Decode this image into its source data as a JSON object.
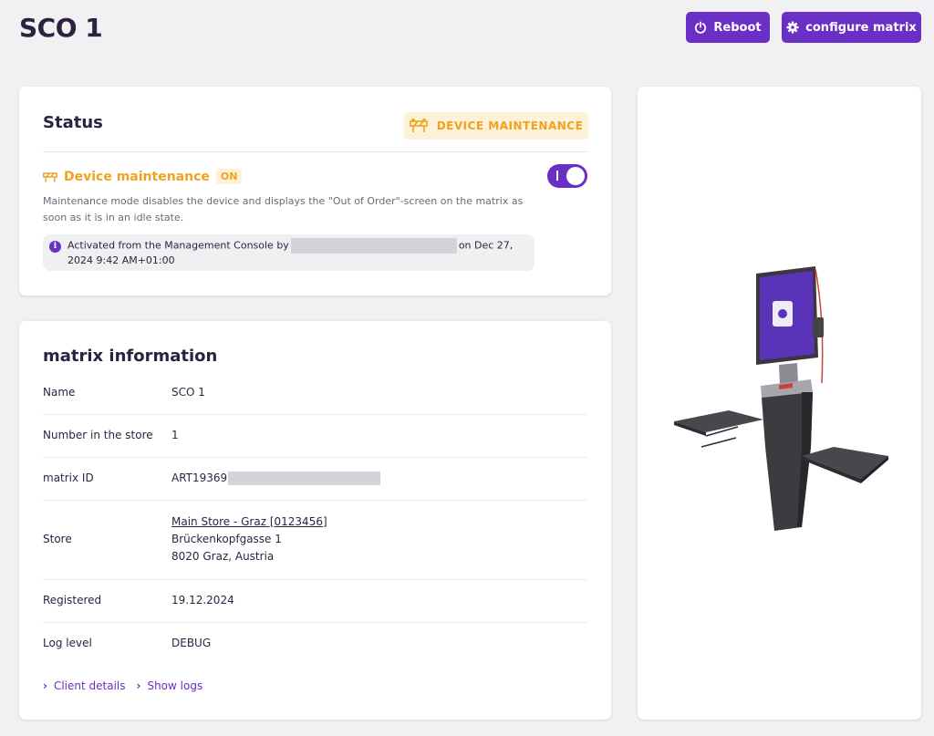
{
  "page": {
    "title": "SCO 1"
  },
  "toolbar": {
    "reboot_label": "Reboot",
    "configure_label": "configure matrix",
    "accent_color": "#6a2fc4"
  },
  "status": {
    "title": "Status",
    "badge_label": "DEVICE MAINTENANCE",
    "maintenance_label": "Device maintenance",
    "maintenance_state": "ON",
    "toggle_on": true,
    "description": "Maintenance mode disables the device and displays the \"Out of Order\"-screen on the matrix as soon as it is in an idle state.",
    "activation_prefix": "Activated from the Management Console by",
    "activation_suffix": "on Dec 27, 2024 9:42 AM+01:00",
    "warning_color": "#f0a21f"
  },
  "info": {
    "title": "matrix information",
    "rows": {
      "name": {
        "label": "Name",
        "value": "SCO 1"
      },
      "number": {
        "label": "Number in the store",
        "value": "1"
      },
      "matrix_id": {
        "label": "matrix ID",
        "value": "ART19369"
      },
      "store": {
        "label": "Store",
        "link": "Main Store - Graz [0123456]",
        "street": "Brückenkopfgasse 1",
        "city": "8020 Graz, Austria"
      },
      "registered": {
        "label": "Registered",
        "value": "19.12.2024"
      },
      "log_level": {
        "label": "Log level",
        "value": "DEBUG"
      }
    },
    "links": {
      "client_details": "Client details",
      "show_logs": "Show logs"
    }
  },
  "icons": {
    "reboot": "power-icon",
    "configure": "gear-icon",
    "maintenance": "barrier-icon",
    "info": "info-icon",
    "chevron": "chevron-right-icon"
  }
}
